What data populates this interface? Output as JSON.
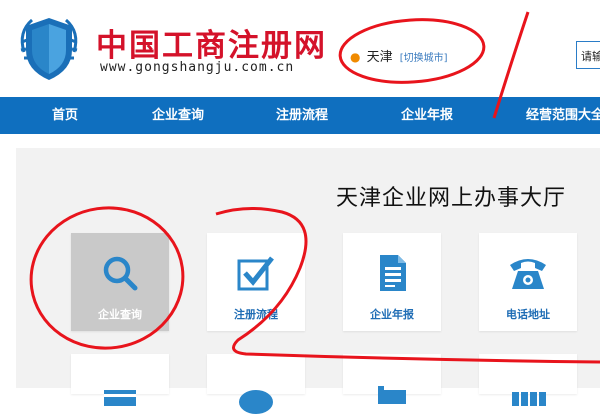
{
  "header": {
    "logo_title": "中国工商注册网",
    "logo_url": "www.gongshangju.com.cn",
    "city": "天津",
    "city_switch": "[切换城市]",
    "search_placeholder": "请输"
  },
  "nav": {
    "items": [
      {
        "label": "首页"
      },
      {
        "label": "企业查询"
      },
      {
        "label": "注册流程"
      },
      {
        "label": "企业年报"
      },
      {
        "label": "经营范围大全"
      }
    ]
  },
  "main": {
    "title": "天津企业网上办事大厅",
    "tiles": [
      {
        "label": "企业查询",
        "icon": "search-icon",
        "active": true
      },
      {
        "label": "注册流程",
        "icon": "checkbox-icon",
        "active": false
      },
      {
        "label": "企业年报",
        "icon": "document-icon",
        "active": false
      },
      {
        "label": "电话地址",
        "icon": "telephone-icon",
        "active": false
      }
    ]
  },
  "colors": {
    "brand_red": "#d4122a",
    "nav_blue": "#0f6fbf",
    "icon_blue": "#2a86c9",
    "annotation_red": "#e8141c"
  }
}
